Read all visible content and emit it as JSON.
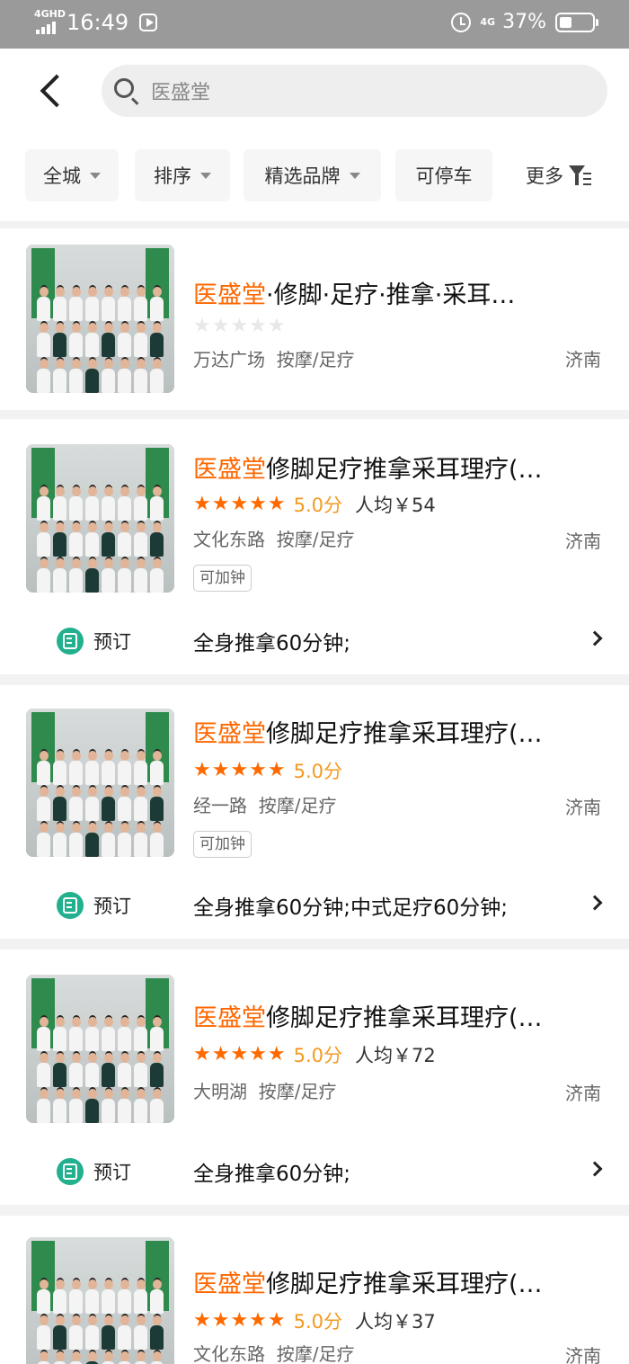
{
  "status_bar": {
    "network": "4GHD",
    "time": "16:49",
    "network2": "4G",
    "battery": "37%",
    "battery_level": 0.37
  },
  "search": {
    "query": "医盛堂"
  },
  "filters": [
    {
      "label": "全城"
    },
    {
      "label": "排序"
    },
    {
      "label": "精选品牌"
    },
    {
      "label": "可停车"
    },
    {
      "label": "更多"
    }
  ],
  "listings": [
    {
      "title_highlight": "医盛堂",
      "title_rest": "·修脚·足疗·推拿·采耳…",
      "stars": 0,
      "score": "",
      "avg_price": "",
      "area": "万达广场",
      "category": "按摩/足疗",
      "city": "济南",
      "tag": "",
      "deal_label": "",
      "deal_text": ""
    },
    {
      "title_highlight": "医盛堂",
      "title_rest": "修脚足疗推拿采耳理疗(…",
      "stars": 5,
      "score": "5.0分",
      "avg_price": "人均￥54",
      "area": "文化东路",
      "category": "按摩/足疗",
      "city": "济南",
      "tag": "可加钟",
      "deal_label": "预订",
      "deal_text": "全身推拿60分钟;"
    },
    {
      "title_highlight": "医盛堂",
      "title_rest": "修脚足疗推拿采耳理疗(…",
      "stars": 5,
      "score": "5.0分",
      "avg_price": "",
      "area": "经一路",
      "category": "按摩/足疗",
      "city": "济南",
      "tag": "可加钟",
      "deal_label": "预订",
      "deal_text": "全身推拿60分钟;中式足疗60分钟;"
    },
    {
      "title_highlight": "医盛堂",
      "title_rest": "修脚足疗推拿采耳理疗(…",
      "stars": 5,
      "score": "5.0分",
      "avg_price": "人均￥72",
      "area": "大明湖",
      "category": "按摩/足疗",
      "city": "济南",
      "tag": "",
      "deal_label": "预订",
      "deal_text": "全身推拿60分钟;"
    },
    {
      "title_highlight": "医盛堂",
      "title_rest": "修脚足疗推拿采耳理疗(…",
      "stars": 5,
      "score": "5.0分",
      "avg_price": "人均￥37",
      "area": "文化东路",
      "category": "按摩/足疗",
      "city": "济南",
      "tag": "",
      "deal_label": "",
      "deal_text": ""
    }
  ]
}
